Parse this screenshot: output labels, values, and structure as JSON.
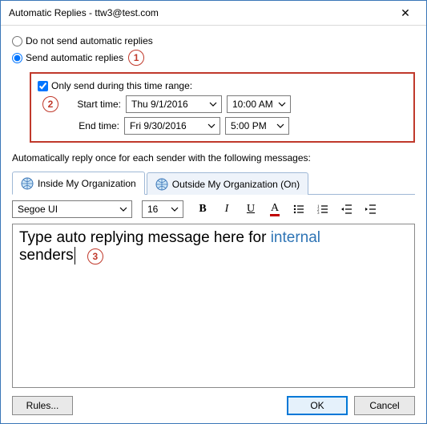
{
  "window": {
    "title": "Automatic Replies - ttw3@test.com",
    "close_icon": "✕"
  },
  "radios": {
    "dont_send": "Do not send automatic replies",
    "send": "Send automatic replies"
  },
  "callouts": {
    "c1": "1",
    "c2": "2",
    "c3": "3"
  },
  "range": {
    "checkbox": "Only send during this time range:",
    "start_label": "Start time:",
    "end_label": "End time:",
    "start_date": "Thu 9/1/2016",
    "start_time": "10:00 AM",
    "end_date": "Fri 9/30/2016",
    "end_time": "5:00 PM"
  },
  "instruction": "Automatically reply once for each sender with the following messages:",
  "tabs": {
    "inside": "Inside My Organization",
    "outside": "Outside My Organization (On)"
  },
  "toolbar": {
    "font": "Segoe UI",
    "size": "16",
    "bold": "B",
    "italic": "I",
    "underline": "U",
    "color": "A"
  },
  "editor": {
    "line1a": "Type auto replying message here for ",
    "line1b": "internal",
    "line2": "senders"
  },
  "footer": {
    "rules": "Rules...",
    "ok": "OK",
    "cancel": "Cancel"
  }
}
